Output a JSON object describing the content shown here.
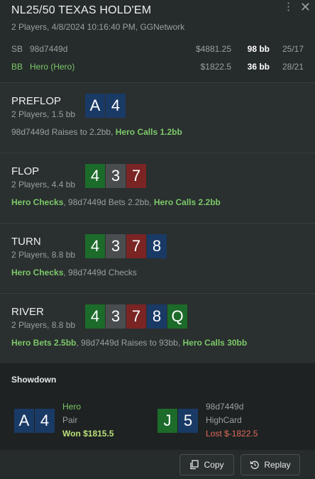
{
  "header": {
    "title": "NL25/50 TEXAS HOLD'EM",
    "subtitle": "2 Players, 4/8/2024 10:16:40 PM, GGNetwork"
  },
  "players": [
    {
      "pos": "SB",
      "name": "98d7449d",
      "stack": "$4881.25",
      "bb": "98 bb",
      "vpip": "25/17",
      "hero": false
    },
    {
      "pos": "BB",
      "name": "Hero (Hero)",
      "stack": "$1822.5",
      "bb": "36 bb",
      "vpip": "28/21",
      "hero": true
    }
  ],
  "streets": [
    {
      "name": "PREFLOP",
      "sub": "2 Players, 1.5 bb",
      "cards": [
        {
          "rank": "A",
          "suit": "d"
        },
        {
          "rank": "4",
          "suit": "d"
        }
      ],
      "actions": [
        {
          "text": "98d7449d Raises to 2.2bb",
          "hero": false
        },
        {
          "text": "Hero Calls 1.2bb",
          "hero": true
        }
      ]
    },
    {
      "name": "FLOP",
      "sub": "2 Players, 4.4 bb",
      "cards": [
        {
          "rank": "4",
          "suit": "c"
        },
        {
          "rank": "3",
          "suit": "s"
        },
        {
          "rank": "7",
          "suit": "h"
        }
      ],
      "actions": [
        {
          "text": "Hero Checks",
          "hero": true
        },
        {
          "text": "98d7449d Bets 2.2bb",
          "hero": false
        },
        {
          "text": "Hero Calls 2.2bb",
          "hero": true
        }
      ]
    },
    {
      "name": "TURN",
      "sub": "2 Players, 8.8 bb",
      "cards": [
        {
          "rank": "4",
          "suit": "c"
        },
        {
          "rank": "3",
          "suit": "s"
        },
        {
          "rank": "7",
          "suit": "h"
        },
        {
          "rank": "8",
          "suit": "d"
        }
      ],
      "actions": [
        {
          "text": "Hero Checks",
          "hero": true
        },
        {
          "text": "98d7449d Checks",
          "hero": false
        }
      ]
    },
    {
      "name": "RIVER",
      "sub": "2 Players, 8.8 bb",
      "cards": [
        {
          "rank": "4",
          "suit": "c"
        },
        {
          "rank": "3",
          "suit": "s"
        },
        {
          "rank": "7",
          "suit": "h"
        },
        {
          "rank": "8",
          "suit": "d"
        },
        {
          "rank": "Q",
          "suit": "c"
        }
      ],
      "actions": [
        {
          "text": "Hero Bets 2.5bb",
          "hero": true
        },
        {
          "text": "98d7449d Raises to 93bb",
          "hero": false
        },
        {
          "text": "Hero Calls 30bb",
          "hero": true
        }
      ]
    }
  ],
  "showdown": {
    "title": "Showdown",
    "hands": [
      {
        "name": "Hero",
        "hand": "Pair",
        "result": "Won $1815.5",
        "won": true,
        "cards": [
          {
            "rank": "A",
            "suit": "d"
          },
          {
            "rank": "4",
            "suit": "d"
          }
        ]
      },
      {
        "name": "98d7449d",
        "hand": "HighCard",
        "result": "Lost $-1822.5",
        "won": false,
        "cards": [
          {
            "rank": "J",
            "suit": "c"
          },
          {
            "rank": "5",
            "suit": "d"
          }
        ]
      }
    ]
  },
  "footer": {
    "copy_label": "Copy",
    "replay_label": "Replay"
  },
  "colors": {
    "club": "#1c6b2a",
    "diamond": "#1a3a66",
    "spade": "#4a4d50",
    "heart": "#7a2424",
    "hero": "#7cc96a",
    "won": "#b8e07a",
    "lost": "#e06a5a"
  }
}
